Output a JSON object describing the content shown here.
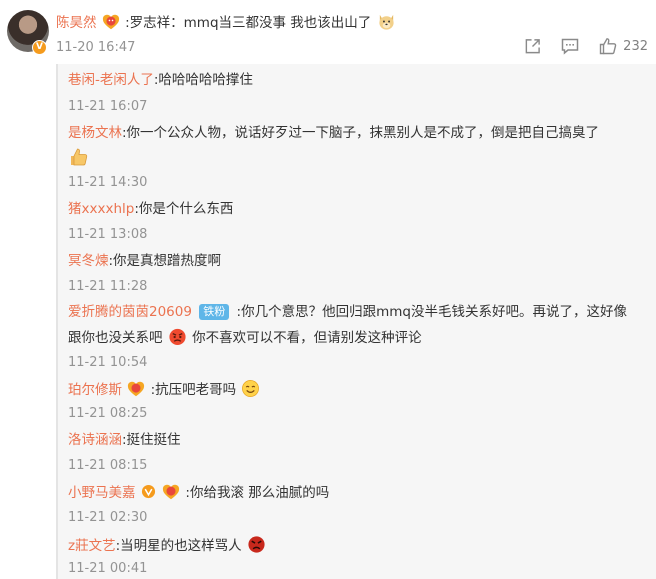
{
  "main_comment": {
    "author": "陈昊然",
    "text": ":罗志祥：mmq当三都没事 我也该出山了",
    "time": "11-20 16:47",
    "like_count": "232"
  },
  "replies": [
    {
      "author": "巷闲-老闲人了",
      "text": ":哈哈哈哈哈撑住",
      "time": "11-21 16:07"
    },
    {
      "author": "是杨文林",
      "text": ":你一个公众人物，说话好歹过一下脑子，抹黑别人是不成了，倒是把自己搞臭了",
      "time": "11-21 14:30"
    },
    {
      "author": "猪xxxxhlp",
      "text": ":你是个什么东西",
      "time": "11-21 13:08"
    },
    {
      "author": "冥冬煉",
      "text": ":你是真想蹭热度啊",
      "time": "11-21 11:28"
    },
    {
      "author": "爱折腾的茵茵20609",
      "badge": "铁粉",
      "text1": ":你几个意思？他回归跟mmq没半毛钱关系好吧。再说了，这好像",
      "text2a": "跟你也没关系吧",
      "text2b": "你不喜欢可以不看，但请别发这种评论",
      "time": "11-21 10:54"
    },
    {
      "author": "珀尔修斯",
      "text": ":抗压吧老哥吗",
      "time": "11-21 08:25"
    },
    {
      "author": "洛诗涵涵",
      "text": ":挺住挺住",
      "time": "11-21 08:15"
    },
    {
      "author": "小野马美嘉",
      "text": ":你给我滚 那么油腻的吗",
      "time": "11-21 02:30"
    },
    {
      "author": "z莊文艺",
      "text": ":当明星的也这样骂人",
      "time": "11-21 00:41"
    }
  ]
}
